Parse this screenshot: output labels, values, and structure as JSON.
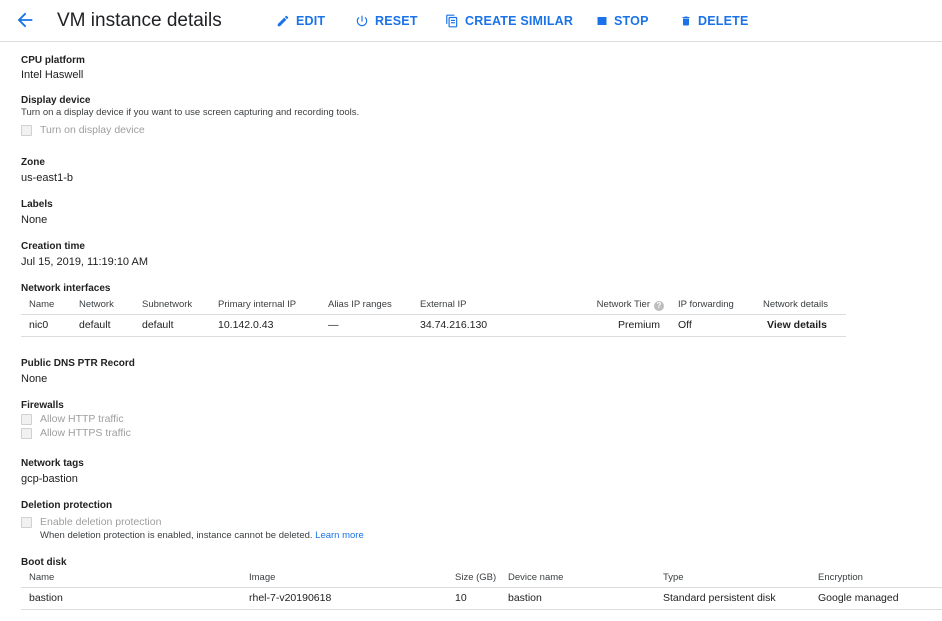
{
  "header": {
    "title": "VM instance details",
    "actions": {
      "edit": "EDIT",
      "reset": "RESET",
      "create_similar": "CREATE SIMILAR",
      "stop": "STOP",
      "delete": "DELETE"
    },
    "accent_color": "#1a73e8"
  },
  "cpu_platform": {
    "label": "CPU platform",
    "value": "Intel Haswell"
  },
  "display_device": {
    "label": "Display device",
    "description": "Turn on a display device if you want to use screen capturing and recording tools.",
    "checkbox_label": "Turn on display device"
  },
  "zone": {
    "label": "Zone",
    "value": "us-east1-b"
  },
  "labels": {
    "label": "Labels",
    "value": "None"
  },
  "creation_time": {
    "label": "Creation time",
    "value": "Jul 15, 2019, 11:19:10 AM"
  },
  "network_interfaces": {
    "label": "Network interfaces",
    "columns": [
      "Name",
      "Network",
      "Subnetwork",
      "Primary internal IP",
      "Alias IP ranges",
      "External IP",
      "Network Tier",
      "IP forwarding",
      "Network details"
    ],
    "rows": [
      {
        "name": "nic0",
        "network": "default",
        "subnetwork": "default",
        "primary_ip": "10.142.0.43",
        "alias_ip": "—",
        "external_ip": "34.74.216.130",
        "tier": "Premium",
        "ip_forwarding": "Off",
        "details": "View details"
      }
    ]
  },
  "public_dns": {
    "label": "Public DNS PTR Record",
    "value": "None"
  },
  "firewalls": {
    "label": "Firewalls",
    "http": "Allow HTTP traffic",
    "https": "Allow HTTPS traffic"
  },
  "network_tags": {
    "label": "Network tags",
    "value": "gcp-bastion"
  },
  "deletion_protection": {
    "label": "Deletion protection",
    "checkbox_label": "Enable deletion protection",
    "description": "When deletion protection is enabled, instance cannot be deleted.",
    "learn_more": "Learn more"
  },
  "boot_disk": {
    "label": "Boot disk",
    "columns": [
      "Name",
      "Image",
      "Size (GB)",
      "Device name",
      "Type",
      "Encryption"
    ],
    "rows": [
      {
        "name": "bastion",
        "image": "rhel-7-v20190618",
        "size": "10",
        "device": "bastion",
        "type": "Standard persistent disk",
        "encryption": "Google managed"
      }
    ]
  }
}
